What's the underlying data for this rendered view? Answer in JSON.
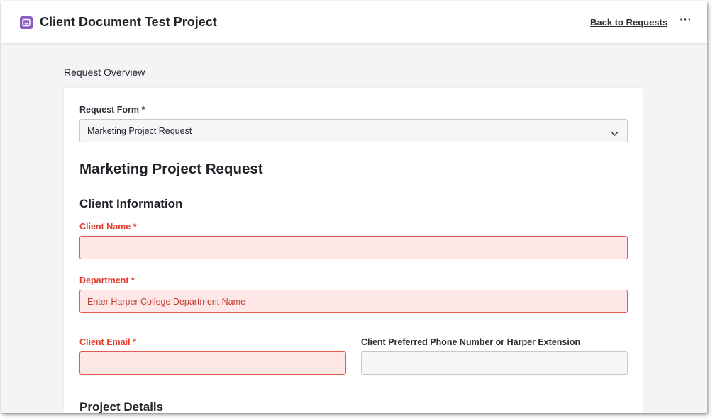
{
  "header": {
    "app_icon": "inbox-icon",
    "title": "Client Document Test Project",
    "back_link": "Back to Requests",
    "more_menu": "···"
  },
  "overview": {
    "label": "Request Overview"
  },
  "request_form": {
    "label": "Request Form *",
    "selected": "Marketing Project Request"
  },
  "form": {
    "title": "Marketing Project Request",
    "client_info_heading": "Client Information",
    "client_name": {
      "label": "Client Name *",
      "value": "",
      "placeholder": ""
    },
    "department": {
      "label": "Department *",
      "value": "",
      "placeholder": "Enter Harper College Department Name"
    },
    "client_email": {
      "label": "Client Email *",
      "value": "",
      "placeholder": ""
    },
    "client_phone": {
      "label": "Client Preferred Phone Number or Harper Extension",
      "value": "",
      "placeholder": ""
    },
    "project_details_heading": "Project Details"
  },
  "colors": {
    "accent": "#8b5cc4",
    "error_text": "#e03e2d",
    "error_bg": "#fde7e7",
    "error_border": "#e05a4d"
  }
}
